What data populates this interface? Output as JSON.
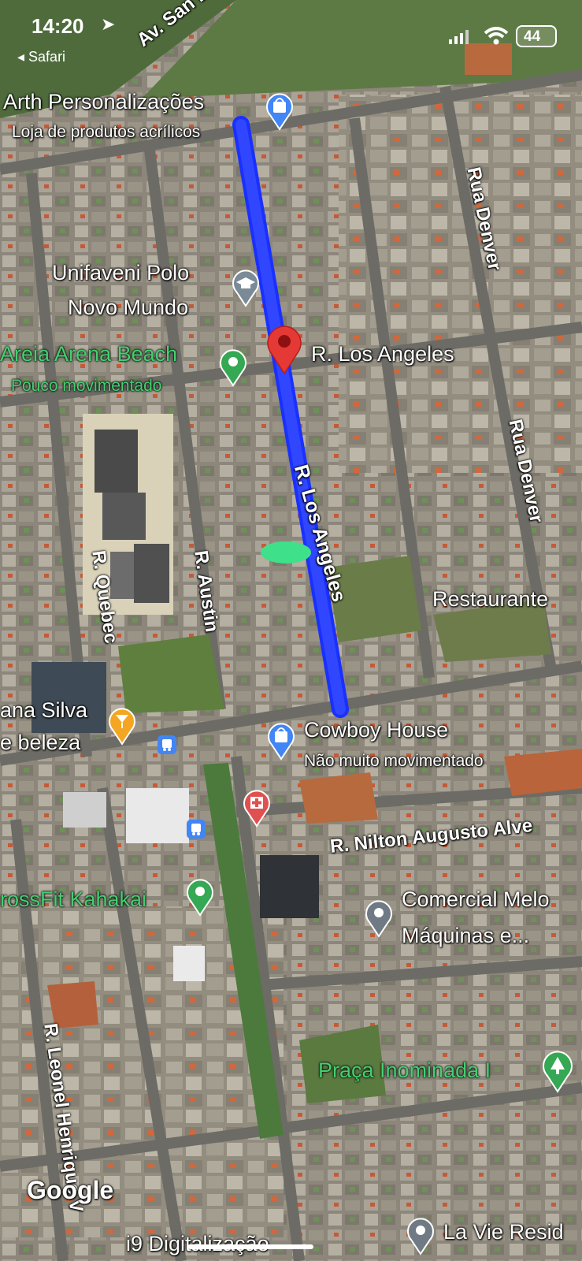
{
  "status_bar": {
    "time": "14:20",
    "back_app": "◂ Safari",
    "battery": "44"
  },
  "streets": {
    "av_san": "Av. San B",
    "rua_denver_1": "Rua Denver",
    "rua_denver_2": "Rua Denver",
    "r_los_angeles_h": "R. Los Angeles",
    "r_los_angeles_v": "R. Los Angeles",
    "r_quebec": "R. Quebec",
    "r_austin": "R. Austin",
    "r_nilton": "R. Nilton Augusto Alve",
    "r_leonel": "R. Leonel Henrique V"
  },
  "places": {
    "arth_title": "Arth Personalizações",
    "arth_sub": "Loja de produtos acrílicos",
    "unifaveni_1": "Unifaveni Polo",
    "unifaveni_2": "Novo Mundo",
    "areia_title": "Areia Arena Beach",
    "areia_sub": "Pouco movimentado",
    "restaurante": "Restaurante",
    "ana_1": "ana Silva",
    "ana_2": "e beleza",
    "cowboy_title": "Cowboy House",
    "cowboy_sub": "Não muito movimentado",
    "crossfit": "rossFit Kahakai",
    "comercial_1": "Comercial Melo",
    "comercial_2": "Máquinas e...",
    "praca": "Praça Inominada I",
    "la_vie": "La Vie Resid",
    "i9": "i9 Digitalização"
  },
  "watermark": "Google",
  "colors": {
    "route": "#1a30ff",
    "pin_red": "#e53935",
    "park_green": "#43d070",
    "shop_blue": "#4285f4",
    "health_red": "#e05050",
    "food_orange": "#f4a623",
    "gray_pin": "#6f7a85"
  }
}
